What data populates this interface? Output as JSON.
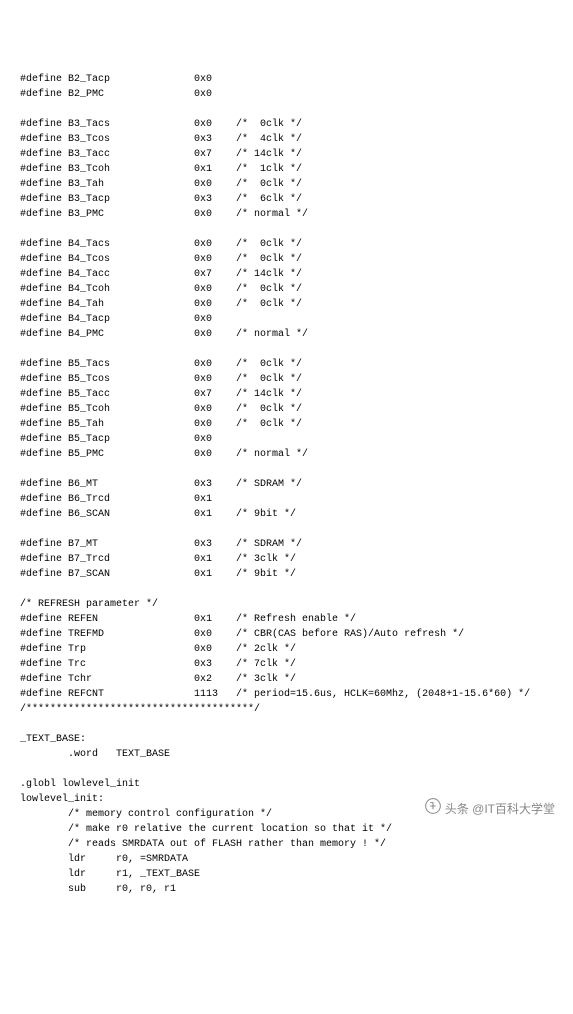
{
  "lines": [
    "#define B2_Tacp              0x0",
    "#define B2_PMC               0x0",
    "",
    "#define B3_Tacs              0x0    /*  0clk */",
    "#define B3_Tcos              0x3    /*  4clk */",
    "#define B3_Tacc              0x7    /* 14clk */",
    "#define B3_Tcoh              0x1    /*  1clk */",
    "#define B3_Tah               0x0    /*  0clk */",
    "#define B3_Tacp              0x3    /*  6clk */",
    "#define B3_PMC               0x0    /* normal */",
    "",
    "#define B4_Tacs              0x0    /*  0clk */",
    "#define B4_Tcos              0x0    /*  0clk */",
    "#define B4_Tacc              0x7    /* 14clk */",
    "#define B4_Tcoh              0x0    /*  0clk */",
    "#define B4_Tah               0x0    /*  0clk */",
    "#define B4_Tacp              0x0",
    "#define B4_PMC               0x0    /* normal */",
    "",
    "#define B5_Tacs              0x0    /*  0clk */",
    "#define B5_Tcos              0x0    /*  0clk */",
    "#define B5_Tacc              0x7    /* 14clk */",
    "#define B5_Tcoh              0x0    /*  0clk */",
    "#define B5_Tah               0x0    /*  0clk */",
    "#define B5_Tacp              0x0",
    "#define B5_PMC               0x0    /* normal */",
    "",
    "#define B6_MT                0x3    /* SDRAM */",
    "#define B6_Trcd              0x1",
    "#define B6_SCAN              0x1    /* 9bit */",
    "",
    "#define B7_MT                0x3    /* SDRAM */",
    "#define B7_Trcd              0x1    /* 3clk */",
    "#define B7_SCAN              0x1    /* 9bit */",
    "",
    "/* REFRESH parameter */",
    "#define REFEN                0x1    /* Refresh enable */",
    "#define TREFMD               0x0    /* CBR(CAS before RAS)/Auto refresh */",
    "#define Trp                  0x0    /* 2clk */",
    "#define Trc                  0x3    /* 7clk */",
    "#define Tchr                 0x2    /* 3clk */",
    "#define REFCNT               1113   /* period=15.6us, HCLK=60Mhz, (2048+1-15.6*60) */",
    "/**************************************/",
    "",
    "_TEXT_BASE:",
    "        .word   TEXT_BASE",
    "",
    ".globl lowlevel_init",
    "lowlevel_init:",
    "        /* memory control configuration */",
    "        /* make r0 relative the current location so that it */",
    "        /* reads SMRDATA out of FLASH rather than memory ! */",
    "        ldr     r0, =SMRDATA",
    "        ldr     r1, _TEXT_BASE",
    "        sub     r0, r0, r1"
  ],
  "watermark": "头条 @IT百科大学堂"
}
